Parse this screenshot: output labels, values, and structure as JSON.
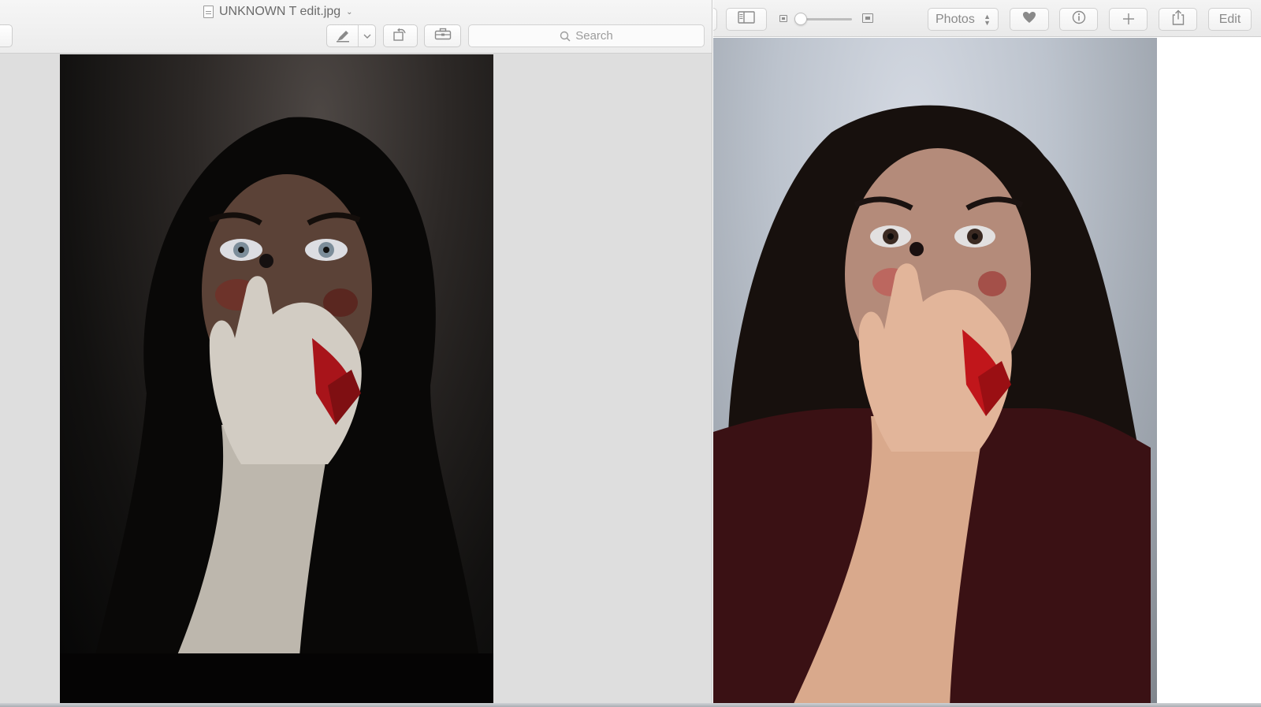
{
  "preview": {
    "document_title": "UNKNOWN T edit.jpg",
    "search_placeholder": "Search",
    "image_alt": "Edited portrait in a dark scene: person with wide eyes covering mouth with a pale hand streaked with red"
  },
  "photos": {
    "view_select_value": "Photos",
    "edit_label": "Edit",
    "image_alt": "Original portrait in a light scene: same person with wide eyes covering mouth with a hand streaked with red"
  },
  "colors": {
    "toolbar_background": "#ececec",
    "preview_canvas": "#dedede",
    "icon_grey": "#8a8a8a",
    "blood_red": "#a8141a"
  },
  "icons": {
    "title_doc": "document-icon",
    "title_menu": "chevron-down-icon",
    "markup": "pen-icon",
    "rotate": "rotate-icon",
    "toolbox": "toolbox-icon",
    "search": "search-icon",
    "sidebar": "sidebar-icon",
    "zoom_out": "zoom-small-icon",
    "zoom_in": "zoom-large-icon",
    "favorite": "heart-icon",
    "info": "info-icon",
    "add": "plus-icon",
    "share": "share-icon"
  }
}
